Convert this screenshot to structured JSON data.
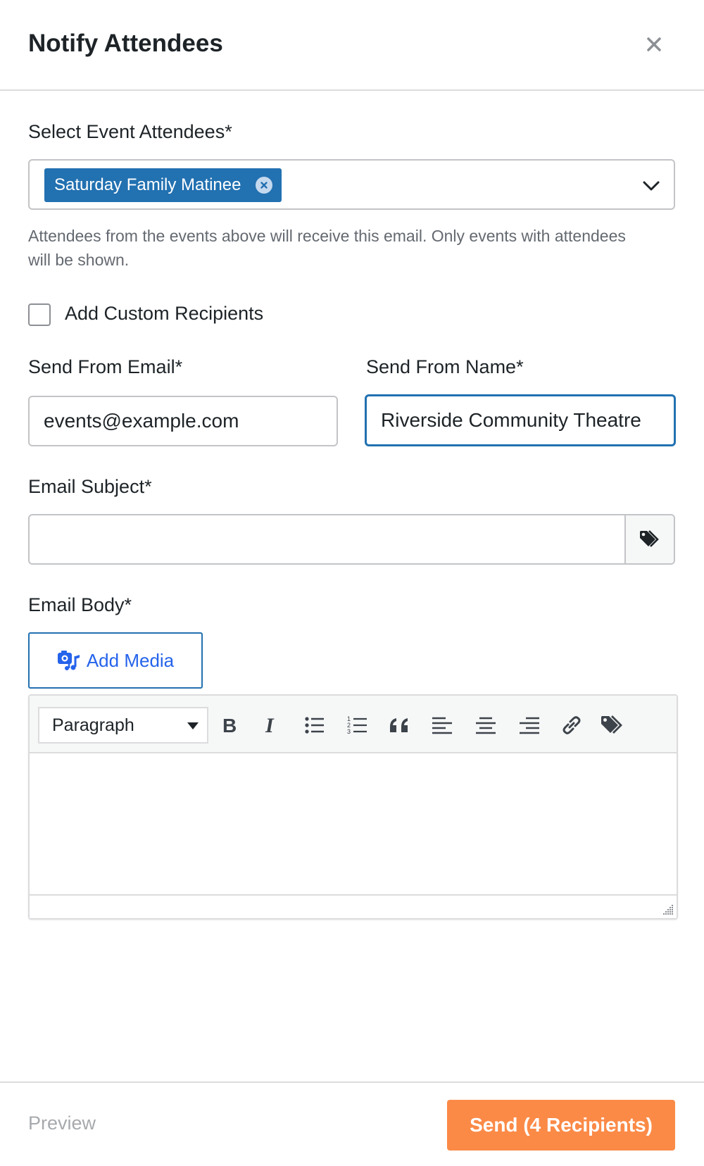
{
  "modal": {
    "title": "Notify Attendees"
  },
  "attendees": {
    "label": "Select Event Attendees*",
    "selected_chip": "Saturday Family Matinee",
    "help_text": "Attendees from the events above will receive this email. Only events with attendees will be shown."
  },
  "custom_recipients": {
    "label": "Add Custom Recipients",
    "checked": false
  },
  "send_from_email": {
    "label": "Send From Email*",
    "value": "events@example.com"
  },
  "send_from_name": {
    "label": "Send From Name*",
    "value": "Riverside Community Theatre"
  },
  "email_subject": {
    "label": "Email Subject*",
    "value": ""
  },
  "email_body": {
    "label": "Email Body*",
    "add_media_label": "Add Media",
    "format_value": "Paragraph",
    "toolbar_icons": [
      "bold-icon",
      "italic-icon",
      "bulleted-list-icon",
      "numbered-list-icon",
      "blockquote-icon",
      "align-left-icon",
      "align-center-icon",
      "align-right-icon",
      "link-icon",
      "tags-icon"
    ]
  },
  "footer": {
    "preview_label": "Preview",
    "send_label": "Send (4 Recipients)"
  },
  "colors": {
    "primary": "#2271b1",
    "send_button": "#fb8a47",
    "muted_text": "#646970",
    "disabled_text": "#a7aaad"
  }
}
